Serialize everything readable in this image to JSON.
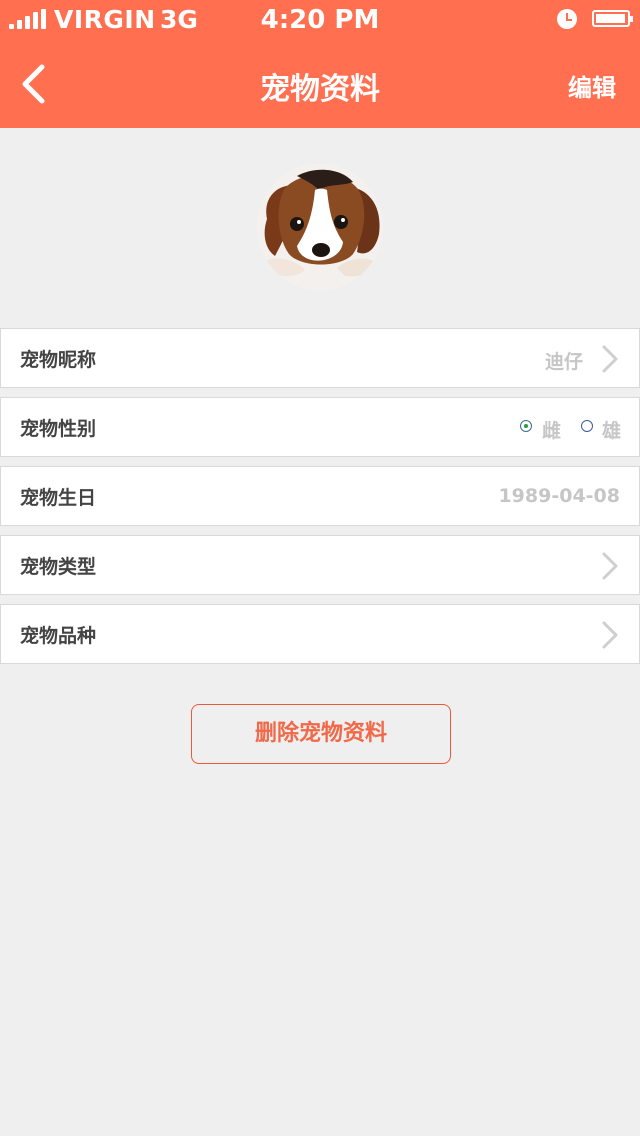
{
  "status_bar": {
    "carrier": "VIRGIN",
    "network": "3G",
    "time": "4:20 PM",
    "icons": [
      "signal-icon",
      "alarm-icon",
      "battery-icon"
    ]
  },
  "nav": {
    "title": "宠物资料",
    "edit_label": "编辑",
    "back_icon": "chevron-left-icon"
  },
  "colors": {
    "accent": "#ff6f50",
    "background": "#efefef",
    "delete_text": "#f06a4a"
  },
  "rows": [
    {
      "label": "宠物昵称",
      "value": "迪仔",
      "has_arrow": true
    },
    {
      "label": "宠物性别",
      "options": [
        "雌",
        "雄"
      ],
      "selected": "雌"
    },
    {
      "label": "宠物生日",
      "value": "1989-04-08",
      "has_arrow": false
    },
    {
      "label": "宠物类型",
      "value": "",
      "has_arrow": true
    },
    {
      "label": "宠物品种",
      "value": "",
      "has_arrow": true
    }
  ],
  "delete_label": "删除宠物资料"
}
